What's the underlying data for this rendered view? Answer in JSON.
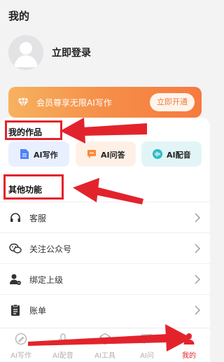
{
  "page": {
    "title": "我的"
  },
  "profile": {
    "login_text": "立即登录"
  },
  "vip": {
    "text": "会员尊享无限AI写作",
    "button": "立即开通"
  },
  "works": {
    "title": "我的作品",
    "items": [
      {
        "label": "AI写作",
        "icon": "document-icon"
      },
      {
        "label": "AI问答",
        "icon": "chat-icon"
      },
      {
        "label": "AI配音",
        "icon": "soundwave-icon"
      }
    ]
  },
  "other": {
    "title": "其他功能",
    "items": [
      {
        "label": "客服",
        "icon": "headset-icon"
      },
      {
        "label": "关注公众号",
        "icon": "wechat-icon"
      },
      {
        "label": "绑定上级",
        "icon": "user-link-icon"
      },
      {
        "label": "账单",
        "icon": "bill-icon"
      }
    ]
  },
  "tabbar": {
    "items": [
      {
        "label": "AI写作",
        "icon": "pen-icon"
      },
      {
        "label": "AI配音",
        "icon": "mic-icon"
      },
      {
        "label": "AI工具",
        "icon": "cube-icon"
      },
      {
        "label": "AI问",
        "icon": "chat-icon"
      },
      {
        "label": "我的",
        "icon": "user-icon",
        "active": true
      }
    ]
  },
  "colors": {
    "accent": "#e3232c",
    "vip_orange": "#f58e49",
    "annotation_red": "#e3232c"
  }
}
